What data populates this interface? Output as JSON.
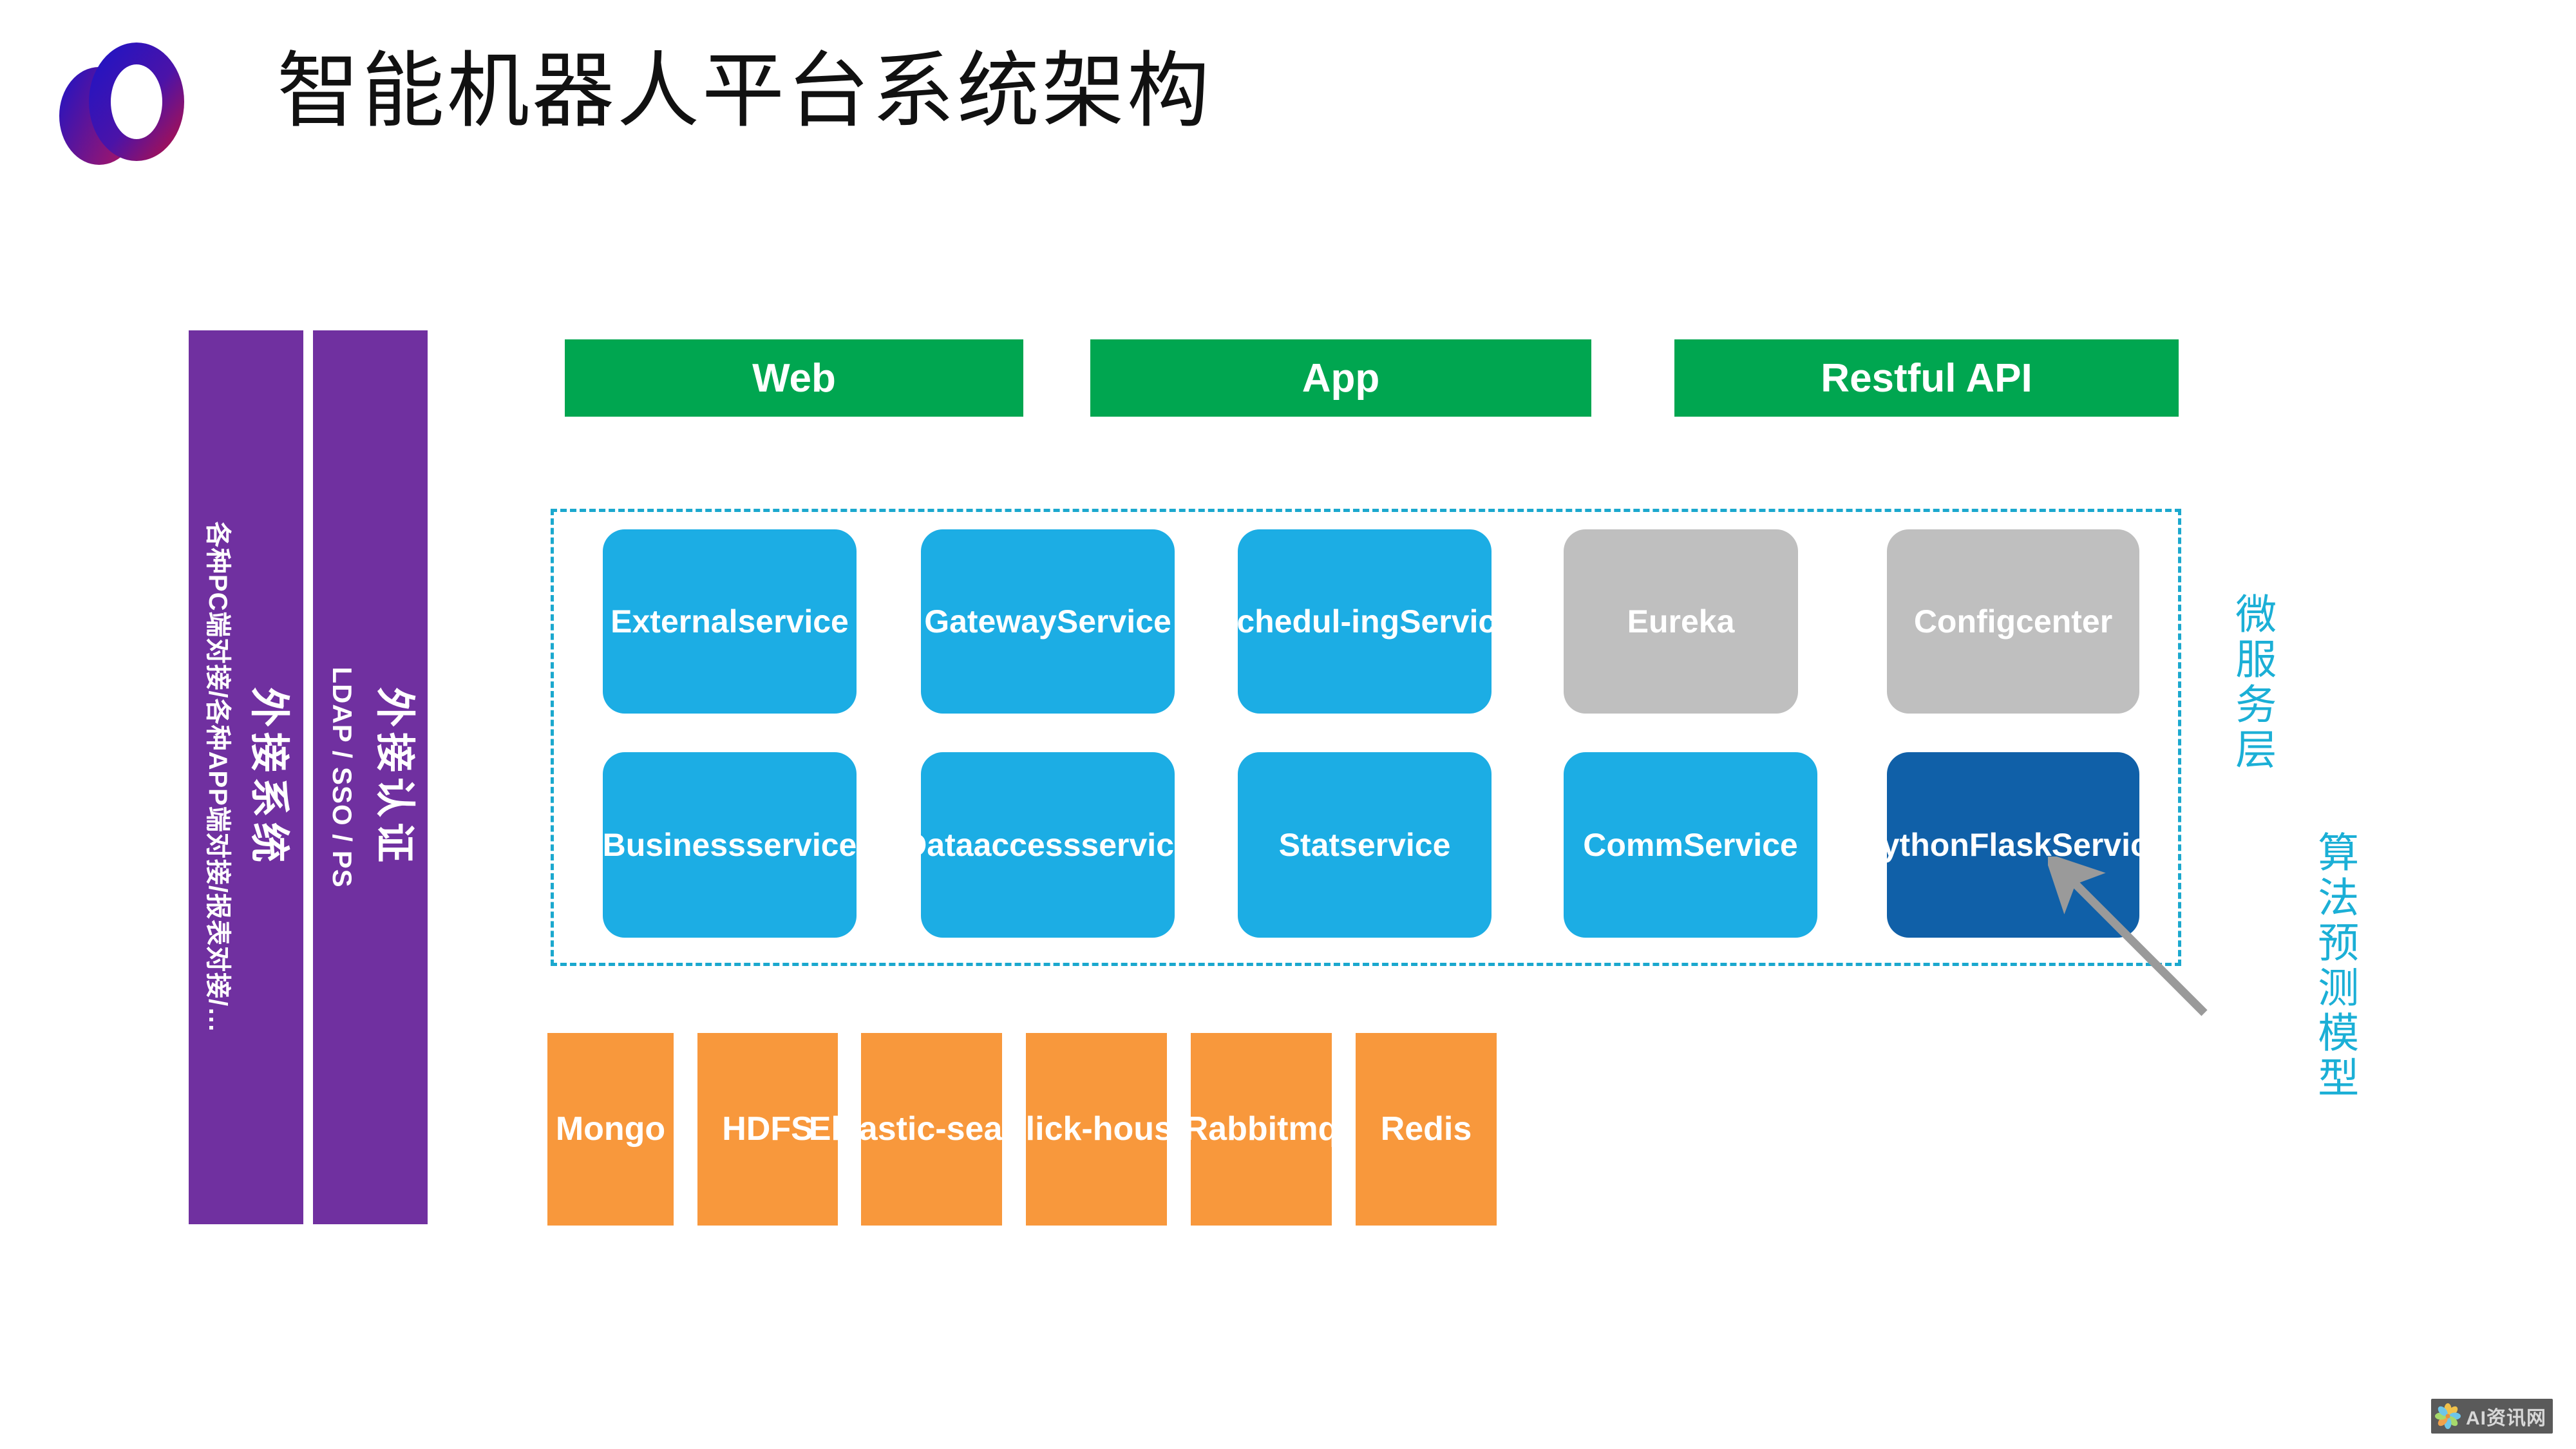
{
  "header": {
    "title": "智能机器人平台系统架构",
    "logo_icon": "overlapping-rings-logo"
  },
  "external_bars": [
    {
      "id": "external-system",
      "title": "外接系统",
      "detail": "各种PC端对接/各种APP端对接/报表对接/…",
      "color": "#7030A0"
    },
    {
      "id": "external-auth",
      "title": "外接认证",
      "detail": "LDAP / SSO / PS",
      "color": "#7030A0"
    }
  ],
  "access_layer": {
    "color": "#00A650",
    "items": [
      {
        "label": "Web"
      },
      {
        "label": "App"
      },
      {
        "label": "Restful API"
      }
    ]
  },
  "microservice_layer": {
    "border_color": "#1BA8CE",
    "row1": [
      {
        "label": "External\nservice",
        "color": "#1CADE4",
        "kind": "blue"
      },
      {
        "label": "Gateway\nService",
        "color": "#1CADE4",
        "kind": "blue"
      },
      {
        "label": "Schedul-\ning\nService",
        "color": "#1CADE4",
        "kind": "blue"
      },
      {
        "label": "Eureka",
        "color": "#BFBFBF",
        "kind": "gray"
      },
      {
        "label": "Config\ncenter",
        "color": "#BFBFBF",
        "kind": "gray"
      }
    ],
    "row2": [
      {
        "label": "Business\nservice",
        "color": "#1CADE4",
        "kind": "blue"
      },
      {
        "label": "Data\naccess\nservice",
        "color": "#1CADE4",
        "kind": "blue"
      },
      {
        "label": "Stat\nservice",
        "color": "#1CADE4",
        "kind": "blue"
      },
      {
        "label": "Comm\nService",
        "color": "#1CADE4",
        "kind": "blue"
      },
      {
        "label": "Python\nFlask\nService",
        "color": "#1060A8",
        "kind": "darkblue"
      }
    ]
  },
  "storage_layer": {
    "color": "#F8983C",
    "items": [
      {
        "label": "Mongo"
      },
      {
        "label": "HDFS"
      },
      {
        "label": "Eleastic-\nsearch"
      },
      {
        "label": "Click-\nhouse"
      },
      {
        "label": "Rabbit\nmq"
      },
      {
        "label": "Redis"
      }
    ]
  },
  "side_labels": {
    "color": "#1BAFD6",
    "microservice": "微服务层",
    "algorithm": "算法预测模型",
    "arrow_icon": "arrow-up-left"
  },
  "watermark": {
    "text": "AI资讯网",
    "icon": "flower-logo"
  }
}
